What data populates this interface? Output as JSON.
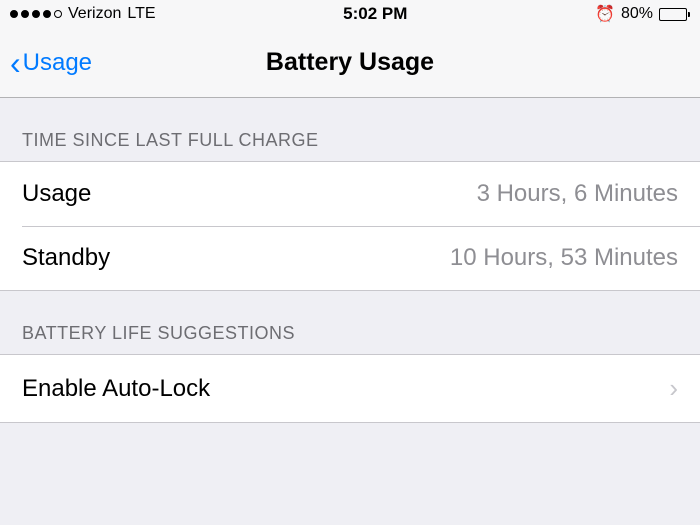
{
  "status": {
    "carrier": "Verizon",
    "connection": "LTE",
    "time": "5:02 PM",
    "battery_pct": "80%",
    "battery_fill_pct": 80
  },
  "nav": {
    "back_label": "Usage",
    "title": "Battery Usage"
  },
  "sections": {
    "last_charge_header": "TIME SINCE LAST FULL CHARGE",
    "usage_label": "Usage",
    "usage_value": "3 Hours, 6 Minutes",
    "standby_label": "Standby",
    "standby_value": "10 Hours, 53 Minutes",
    "suggestions_header": "BATTERY LIFE SUGGESTIONS",
    "autolock_label": "Enable Auto-Lock"
  }
}
